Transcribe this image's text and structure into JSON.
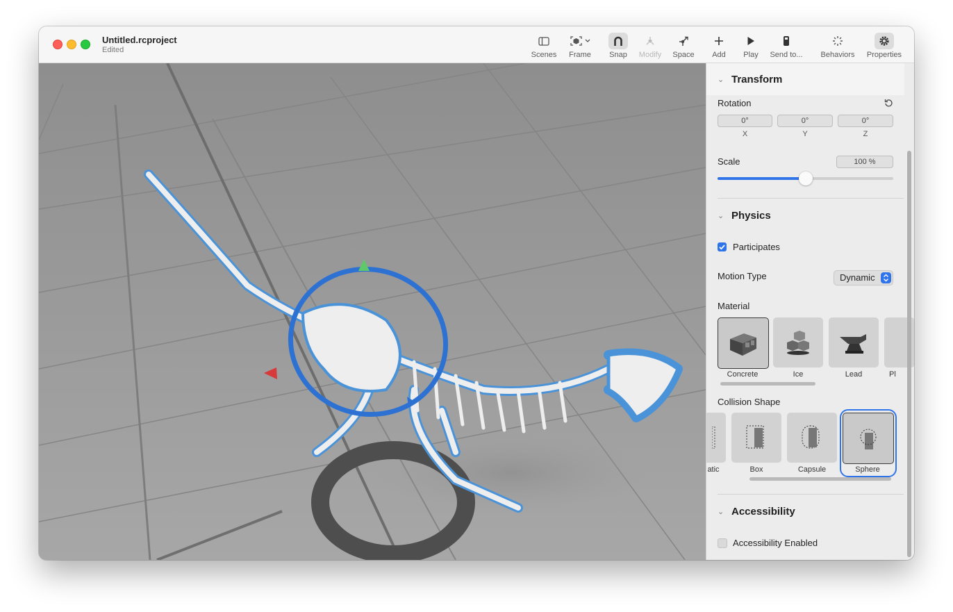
{
  "window": {
    "title": "Untitled.rcproject",
    "subtitle": "Edited"
  },
  "toolbar": {
    "items": [
      {
        "label": "Scenes",
        "icon": "sidebar-icon"
      },
      {
        "label": "Frame",
        "icon": "frame-cube-icon"
      },
      {
        "label": "Snap",
        "icon": "magnet-icon"
      },
      {
        "label": "Modify",
        "icon": "modify-icon"
      },
      {
        "label": "Space",
        "icon": "space-axes-icon"
      },
      {
        "label": "Add",
        "icon": "plus-icon"
      },
      {
        "label": "Play",
        "icon": "play-icon"
      },
      {
        "label": "Send to...",
        "icon": "device-icon"
      },
      {
        "label": "Behaviors",
        "icon": "behaviors-icon"
      },
      {
        "label": "Properties",
        "icon": "gear-icon"
      }
    ]
  },
  "inspector": {
    "transform": {
      "title": "Transform",
      "rotation_label": "Rotation",
      "rotation": {
        "x": "0°",
        "y": "0°",
        "z": "0°"
      },
      "axis_labels": {
        "x": "X",
        "y": "Y",
        "z": "Z"
      },
      "scale_label": "Scale",
      "scale_value": "100 %",
      "scale_fraction": 0.5
    },
    "physics": {
      "title": "Physics",
      "participates_label": "Participates",
      "participates": true,
      "motion_type_label": "Motion Type",
      "motion_type": "Dynamic",
      "material_label": "Material",
      "materials": [
        "Concrete",
        "Ice",
        "Lead",
        "Pl"
      ],
      "selected_material": "Concrete",
      "collision_label": "Collision Shape",
      "collision_shapes": [
        "atic",
        "Box",
        "Capsule",
        "Sphere"
      ],
      "selected_shape": "Sphere"
    },
    "accessibility": {
      "title": "Accessibility",
      "enabled_label": "Accessibility Enabled",
      "enabled": false
    }
  },
  "colors": {
    "accent": "#2f74e8",
    "viewport_floor": "#9d9d9d",
    "selection_outline": "#3b8fd9"
  }
}
